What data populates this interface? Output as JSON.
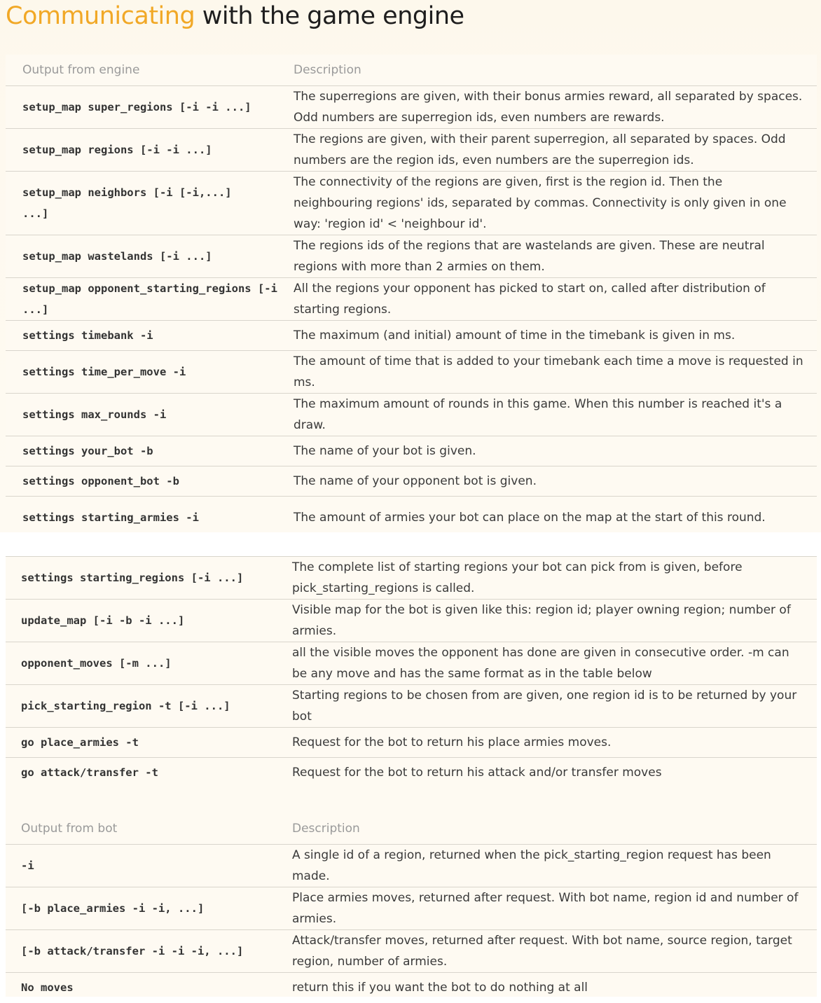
{
  "page": {
    "title_accent": "Communicating",
    "title_rest": " with the game engine"
  },
  "engine_table": {
    "header_command": "Output from engine",
    "header_description": "Description",
    "rows": [
      {
        "command": "setup_map super_regions [-i -i ...]",
        "description": "The superregions are given, with their bonus armies reward, all separated by spaces. Odd numbers are superregion ids, even numbers are rewards."
      },
      {
        "command": "setup_map regions [-i -i ...]",
        "description": "The regions are given, with their parent superregion, all separated by spaces. Odd numbers are the region ids, even numbers are the superregion ids."
      },
      {
        "command": "setup_map neighbors [-i [-i,...] ...]",
        "description": "The connectivity of the regions are given, first is the region id. Then the neighbouring regions' ids, separated by commas. Connectivity is only given in one way: 'region id' < 'neighbour id'."
      },
      {
        "command": "setup_map wastelands [-i ...]",
        "description": "The regions ids of the regions that are wastelands are given. These are neutral regions with more than 2 armies on them."
      },
      {
        "command": "setup_map opponent_starting_regions [-i ...]",
        "description": "All the regions your opponent has picked to start on, called after distribution of starting regions."
      },
      {
        "command": "settings timebank -i",
        "description": "The maximum (and initial) amount of time in the timebank is given in ms."
      },
      {
        "command": "settings time_per_move -i",
        "description": "The amount of time that is added to your timebank each time a move is requested in ms."
      },
      {
        "command": "settings max_rounds -i",
        "description": "The maximum amount of rounds in this game. When this number is reached it's a draw."
      },
      {
        "command": "settings your_bot -b",
        "description": "The name of your bot is given."
      },
      {
        "command": "settings opponent_bot -b",
        "description": "The name of your opponent bot is given."
      },
      {
        "command": "settings starting_armies -i",
        "description": "The amount of armies your bot can place on the map at the start of this round."
      }
    ]
  },
  "engine_table_2": {
    "rows": [
      {
        "command": "settings starting_regions [-i ...]",
        "description": "The complete list of starting regions your bot can pick from is given, before pick_starting_regions is called."
      },
      {
        "command": "update_map [-i -b -i ...]",
        "description": "Visible map for the bot is given like this: region id; player owning region; number of armies."
      },
      {
        "command": "opponent_moves [-m ...]",
        "description": "all the visible moves the opponent has done are given in consecutive order. -m can be any move and has the same format as in the table below"
      },
      {
        "command": "pick_starting_region -t [-i ...]",
        "description": "Starting regions to be chosen from are given, one region id is to be returned by your bot"
      },
      {
        "command": "go place_armies -t",
        "description": "Request for the bot to return his place armies moves."
      },
      {
        "command": "go attack/transfer -t",
        "description": "Request for the bot to return his attack and/or transfer moves"
      }
    ]
  },
  "bot_table": {
    "header_command": "Output from bot",
    "header_description": "Description",
    "rows": [
      {
        "command": "-i",
        "description": "A single id of a region, returned when the pick_starting_region request has been made."
      },
      {
        "command": "[-b place_armies -i -i, ...]",
        "description": "Place armies moves, returned after request. With bot name, region id and number of armies."
      },
      {
        "command": "[-b attack/transfer -i -i -i, ...]",
        "description": "Attack/transfer moves, returned after request. With bot name, source region, target region, number of armies."
      },
      {
        "command": "No moves",
        "description": "return this if you want the bot to do nothing at all"
      }
    ]
  }
}
